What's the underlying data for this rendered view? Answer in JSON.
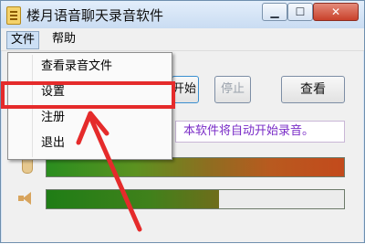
{
  "window": {
    "title": "楼月语音聊天录音软件",
    "controls": {
      "minimize": "▁",
      "maximize": "☐",
      "close": "✕"
    }
  },
  "menubar": {
    "file": "文件",
    "help": "帮助"
  },
  "file_menu": {
    "items": [
      {
        "label": "查看录音文件"
      },
      {
        "label": "设置"
      },
      {
        "label": "注册"
      },
      {
        "label": "退出"
      }
    ],
    "highlighted_item": "设置"
  },
  "main": {
    "start_button_partial": "开始",
    "stop_button": "停止",
    "view_button": "查看",
    "notice_text": "本软件将自动开始录音。",
    "mic_level": 1.0,
    "speaker_level": 0.58
  },
  "icons": {
    "app": "recorder-app-icon",
    "mic": "microphone-icon",
    "speaker": "speaker-icon"
  },
  "colors": {
    "highlight": "#e52b2b",
    "notice_text": "#7a2cc7"
  }
}
